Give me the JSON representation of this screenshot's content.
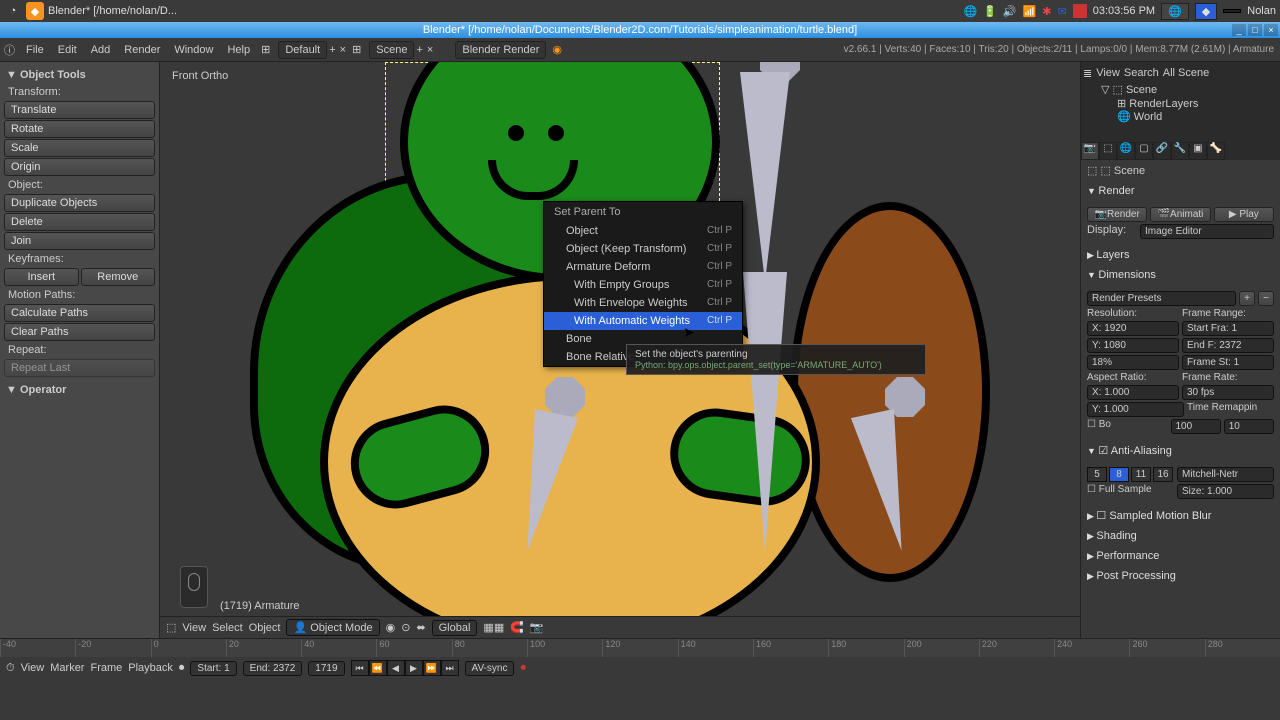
{
  "os": {
    "app_title": "Blender* [/home/nolan/D...",
    "clock": "03:03:56 PM",
    "user": "Nolan"
  },
  "window": {
    "title": "Blender* [/home/nolan/Documents/Blender2D.com/Tutorials/simpleanimation/turtle.blend]"
  },
  "menubar": {
    "items": [
      "File",
      "Edit",
      "Add",
      "Render",
      "Window",
      "Help"
    ],
    "layout": "Default",
    "scene": "Scene",
    "engine": "Blender Render",
    "stats": "v2.66.1 | Verts:40 | Faces:10 | Tris:20 | Objects:2/11 | Lamps:0/0 | Mem:8.77M (2.61M) | Armature"
  },
  "toolshelf": {
    "header": "Object Tools",
    "transform_lbl": "Transform:",
    "translate": "Translate",
    "rotate": "Rotate",
    "scale": "Scale",
    "origin": "Origin",
    "object_lbl": "Object:",
    "duplicate": "Duplicate Objects",
    "delete": "Delete",
    "join": "Join",
    "keyframes_lbl": "Keyframes:",
    "insert": "Insert",
    "remove": "Remove",
    "motion_lbl": "Motion Paths:",
    "calc": "Calculate Paths",
    "clear": "Clear Paths",
    "repeat_lbl": "Repeat:",
    "repeat_last": "Repeat Last",
    "operator": "Operator"
  },
  "viewport": {
    "view_label": "Front Ortho",
    "frame_label": "(1719) Armature",
    "header": {
      "view": "View",
      "select": "Select",
      "object": "Object",
      "mode": "Object Mode",
      "orient": "Global"
    }
  },
  "context_menu": {
    "title": "Set Parent To",
    "items": [
      {
        "label": "Object",
        "shortcut": "Ctrl P"
      },
      {
        "label": "Object (Keep Transform)",
        "shortcut": "Ctrl P"
      },
      {
        "label": "Armature Deform",
        "shortcut": "Ctrl P"
      },
      {
        "label": "With Empty Groups",
        "shortcut": "Ctrl P",
        "sub": true
      },
      {
        "label": "With Envelope Weights",
        "shortcut": "Ctrl P",
        "sub": true
      },
      {
        "label": "With Automatic Weights",
        "shortcut": "Ctrl P",
        "sub": true,
        "hl": true
      },
      {
        "label": "Bone",
        "shortcut": ""
      },
      {
        "label": "Bone Relative",
        "shortcut": ""
      }
    ],
    "tooltip": {
      "text": "Set the object's parenting",
      "python": "Python: bpy.ops.object.parent_set(type='ARMATURE_AUTO')"
    }
  },
  "outliner": {
    "search_ph": "",
    "view": "View",
    "search": "Search",
    "all": "All Scene",
    "scene": "Scene",
    "renderlayers": "RenderLayers",
    "world": "World"
  },
  "props": {
    "context": "Scene",
    "render_h": "Render",
    "render": "Render",
    "anim": "Animati",
    "play": "Play",
    "display_lbl": "Display:",
    "display": "Image Editor",
    "layers_h": "Layers",
    "dim_h": "Dimensions",
    "presets": "Render Presets",
    "res_lbl": "Resolution:",
    "fr_lbl": "Frame Range:",
    "x": "X: 1920",
    "start": "Start Fra: 1",
    "y": "Y: 1080",
    "end": "End F: 2372",
    "pct": "18%",
    "step": "Frame St: 1",
    "ar_lbl": "Aspect Ratio:",
    "fps_lbl": "Frame Rate:",
    "arx": "X: 1.000",
    "fps": "30 fps",
    "ary": "Y: 1.000",
    "remap": "Time Remappin",
    "bo": "Bo",
    "old": "100",
    "new": "10",
    "aa_h": "Anti-Aliasing",
    "samples": [
      "5",
      "8",
      "11",
      "16"
    ],
    "filter": "Mitchell-Netr",
    "fullsample": "Full Sample",
    "size": "Size: 1.000",
    "smb_h": "Sampled Motion Blur",
    "shading_h": "Shading",
    "perf_h": "Performance",
    "post_h": "Post Processing"
  },
  "timeline": {
    "ticks": [
      "-40",
      "-20",
      "0",
      "20",
      "40",
      "60",
      "80",
      "100",
      "120",
      "140",
      "160",
      "180",
      "200",
      "220",
      "240",
      "260",
      "280"
    ],
    "view": "View",
    "marker": "Marker",
    "frame": "Frame",
    "playback": "Playback",
    "start": "Start: 1",
    "end": "End: 2372",
    "current": "1719",
    "sync": "AV-sync"
  }
}
